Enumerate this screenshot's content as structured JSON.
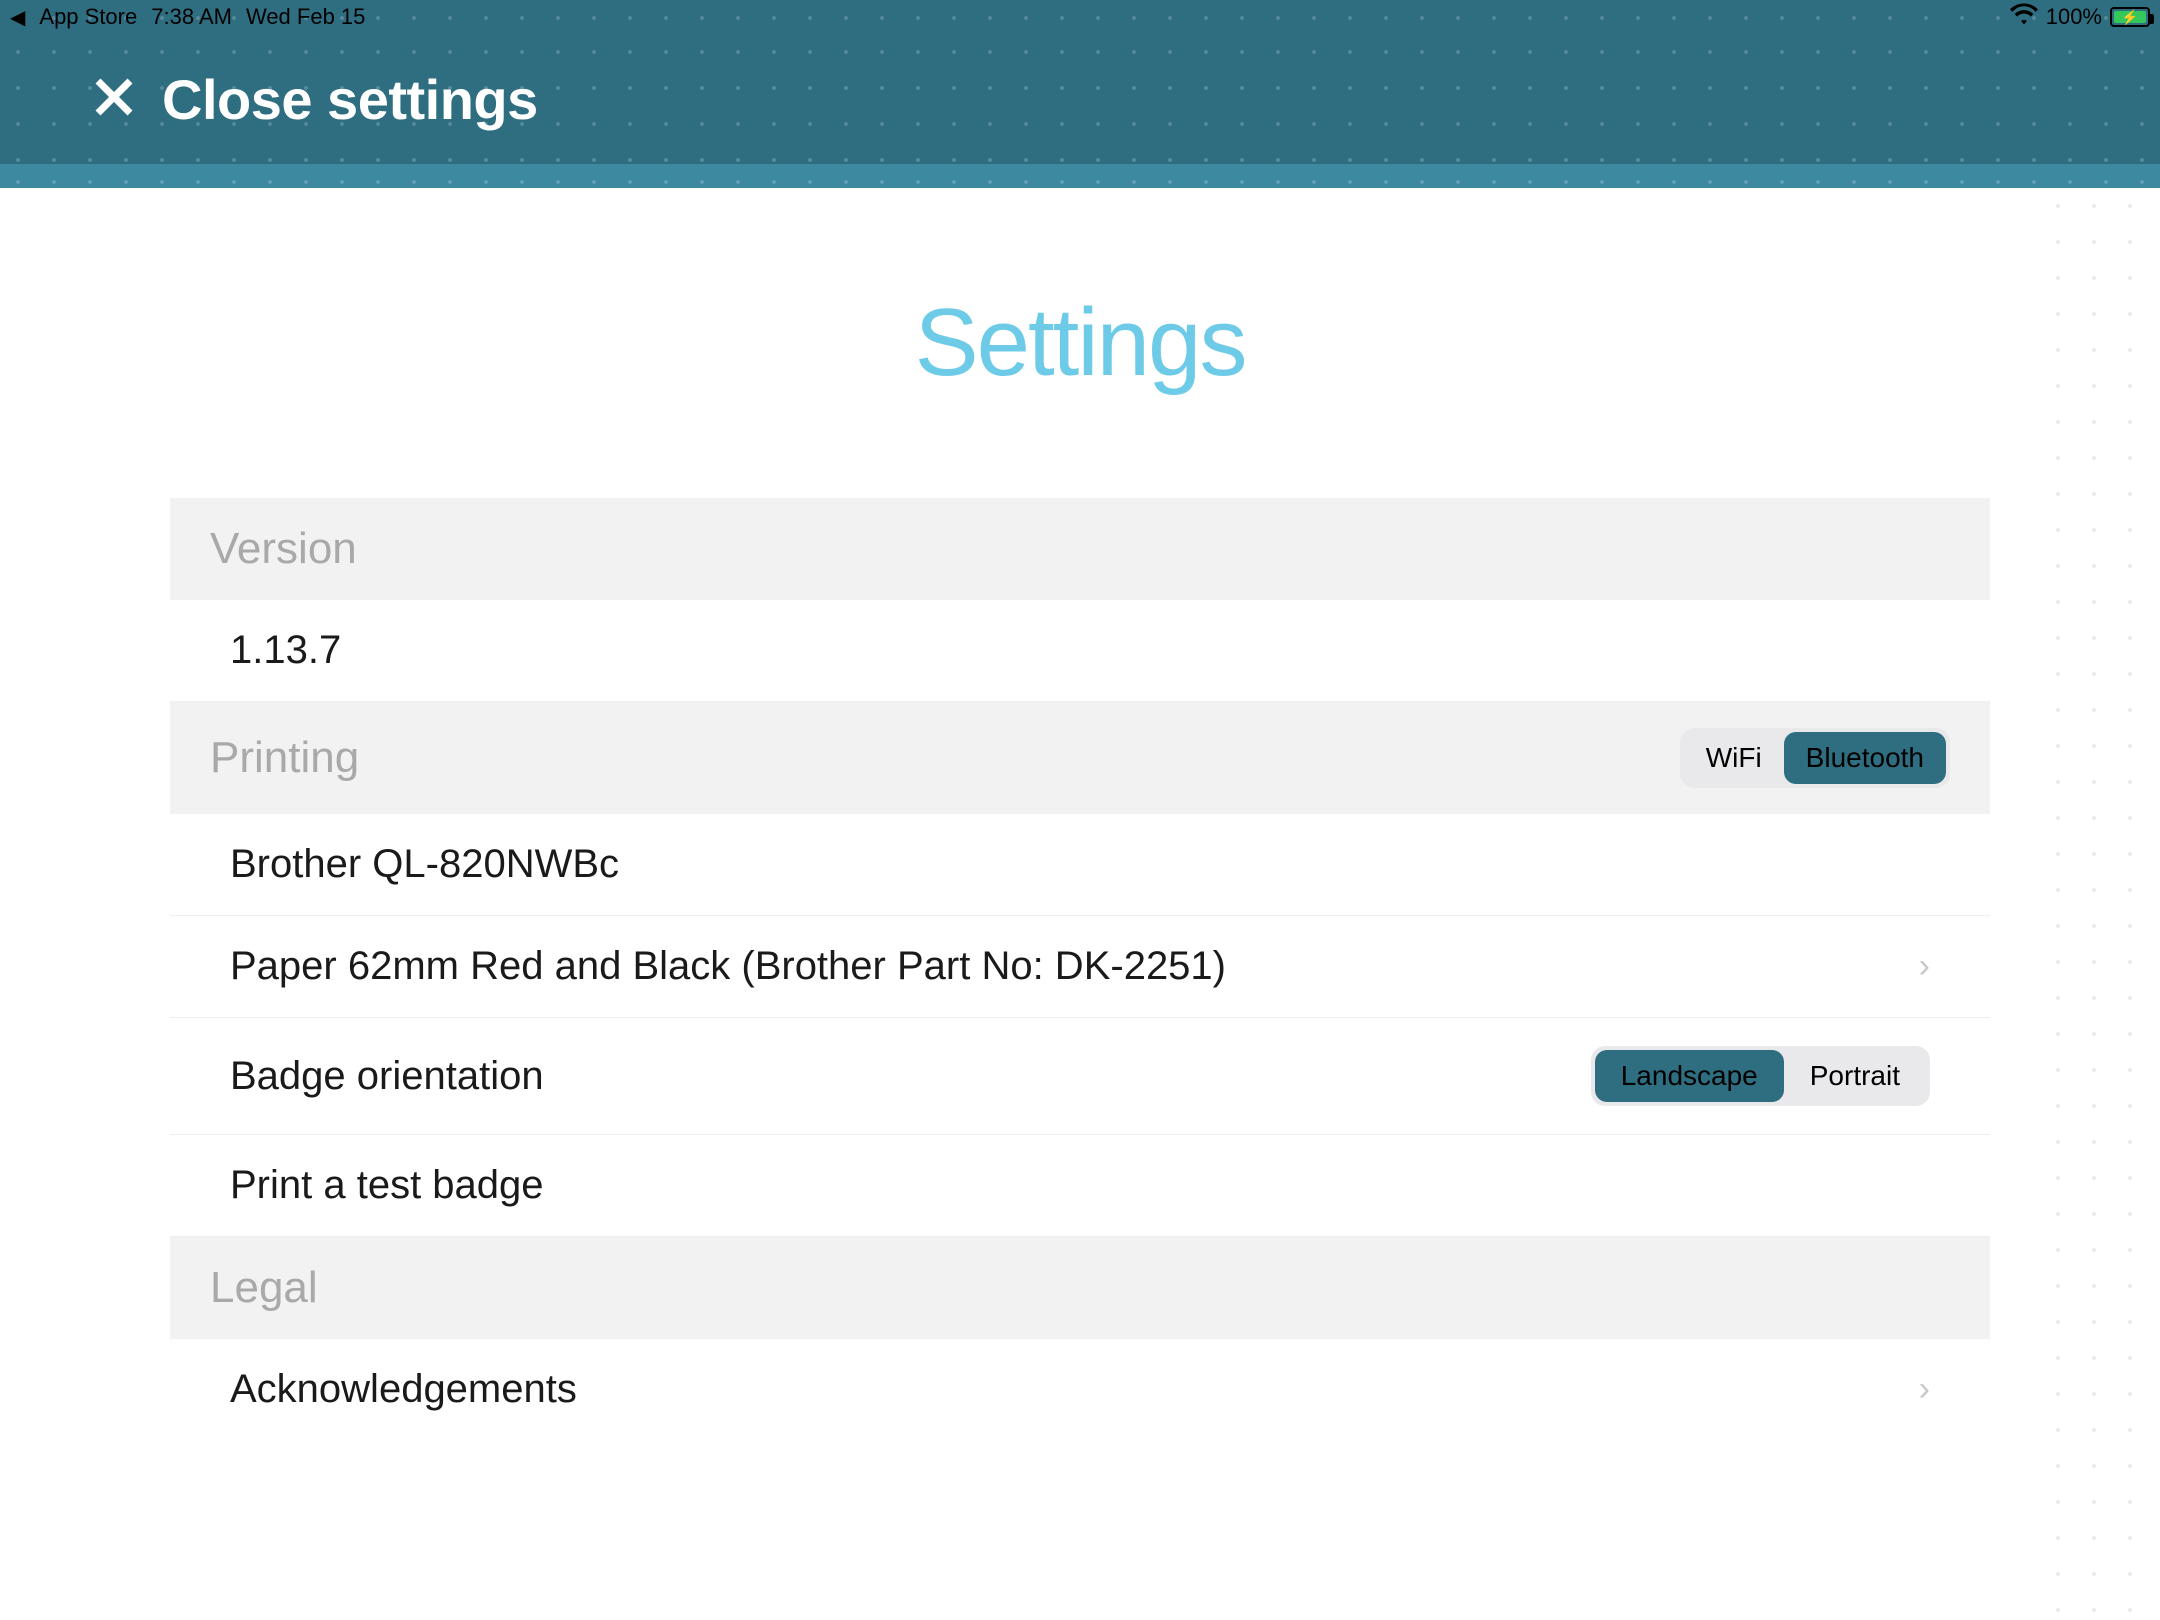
{
  "status_bar": {
    "back_label": "App Store",
    "time": "7:38 AM",
    "date": "Wed Feb 15",
    "battery_pct": "100%"
  },
  "header": {
    "close_label": "Close settings"
  },
  "page": {
    "title": "Settings"
  },
  "sections": {
    "version": {
      "header": "Version",
      "value": "1.13.7"
    },
    "printing": {
      "header": "Printing",
      "connection": {
        "options": [
          "WiFi",
          "Bluetooth"
        ],
        "selected": "Bluetooth"
      },
      "printer": "Brother QL-820NWBc",
      "paper": "Paper 62mm Red and Black (Brother Part No: DK-2251)",
      "orientation_label": "Badge orientation",
      "orientation": {
        "options": [
          "Landscape",
          "Portrait"
        ],
        "selected": "Landscape"
      },
      "test_badge": "Print a test badge"
    },
    "legal": {
      "header": "Legal",
      "acknowledgements": "Acknowledgements"
    }
  }
}
